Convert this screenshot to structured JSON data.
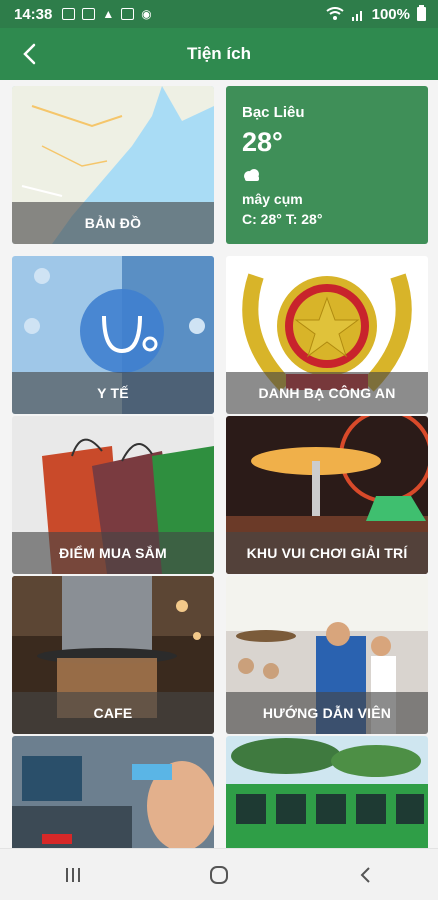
{
  "status_bar": {
    "time": "14:38",
    "battery_text": "100%",
    "icons": [
      "msg-icon",
      "gallery-icon",
      "warning-icon",
      "image-icon",
      "location-icon",
      "wifi-icon",
      "signal-icon",
      "battery-icon"
    ]
  },
  "app_bar": {
    "title": "Tiện ích",
    "back_icon": "back-arrow-icon"
  },
  "weather": {
    "city": "Bạc Liêu",
    "temperature": "28°",
    "condition_icon": "cloud-icon",
    "condition": "mây cụm",
    "range": "C: 28° T: 28°"
  },
  "tiles": {
    "map": "BẢN ĐỒ",
    "health": "Y TẾ",
    "police": "DANH BẠ CÔNG AN",
    "shopping": "ĐIỂM MUA SẮM",
    "amusement": "KHU VUI CHƠI GIẢI TRÍ",
    "cafe": "CAFE",
    "guide": "HƯỚNG DẪN VIÊN"
  },
  "colors": {
    "primary": "#2f8a4f",
    "status_bar": "#2e7d4a",
    "weather_tile": "#3f8f58"
  },
  "nav_bar": {
    "icons": [
      "recent-apps-icon",
      "home-icon",
      "back-icon"
    ]
  }
}
